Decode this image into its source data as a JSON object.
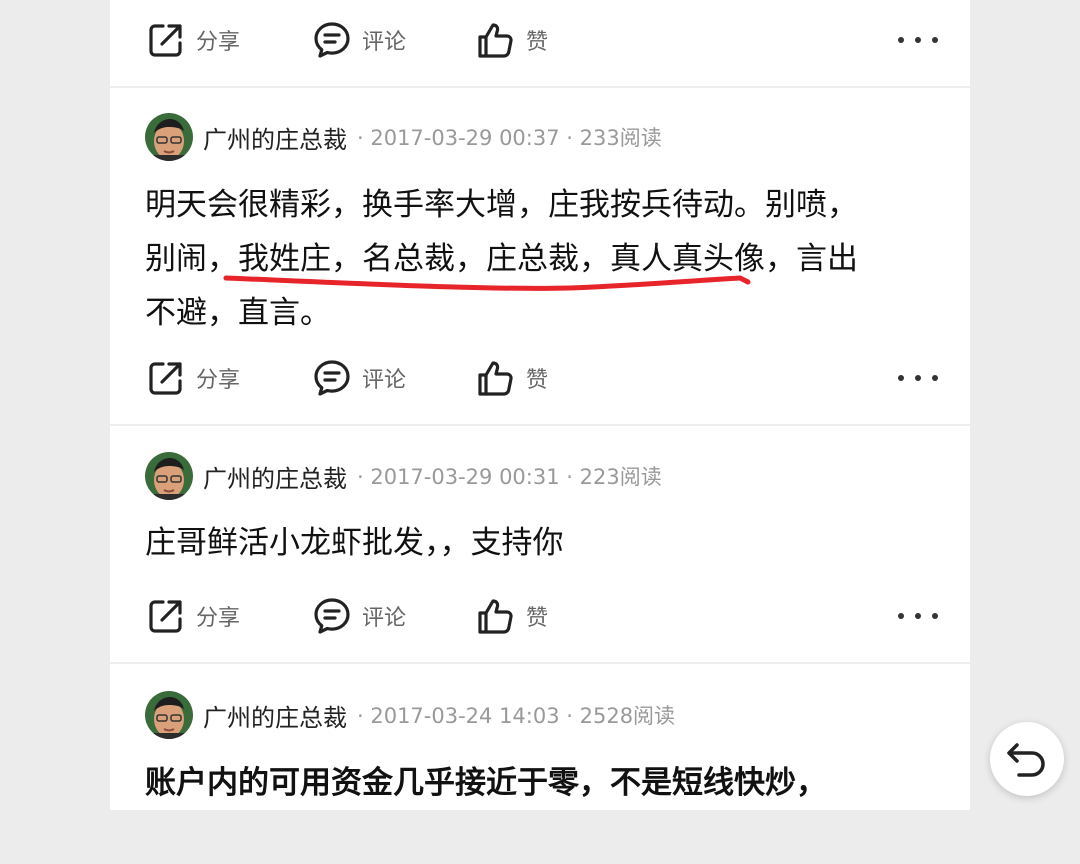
{
  "actions": {
    "share_label": "分享",
    "comment_label": "评论",
    "like_label": "赞"
  },
  "posts": [
    {
      "author": "广州的庄总裁",
      "meta": "· 2017-03-29 00:37 · 233阅读",
      "lines": [
        "明天会很精彩，换手率大增，庄我按兵待动。别喷，",
        "别闹，我姓庄，名总裁，庄总裁，真人真头像，言出",
        "不避，直言。"
      ]
    },
    {
      "author": "广州的庄总裁",
      "meta": "· 2017-03-29 00:31 · 223阅读",
      "lines": [
        "庄哥鲜活小龙虾批发，，支持你"
      ]
    },
    {
      "author": "广州的庄总裁",
      "meta": "· 2017-03-24 14:03 · 2528阅读",
      "lines": [
        "账户内的可用资金几乎接近于零，不是短线快炒，"
      ]
    }
  ],
  "colors": {
    "background": "#ececec",
    "card": "#ffffff",
    "annotation": "#e8242b",
    "meta_text": "#999999"
  },
  "icons": [
    "share-icon",
    "comment-icon",
    "thumbs-up-icon",
    "more-icon",
    "back-icon"
  ]
}
